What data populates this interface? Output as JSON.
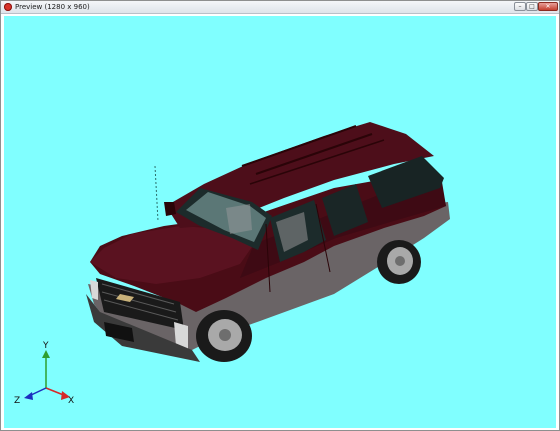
{
  "window": {
    "title": "Preview (1280 x 960)",
    "min_label": "–",
    "max_label": "□",
    "close_label": "✕"
  },
  "viewport": {
    "background": "#80ffff",
    "model": "maroon-suv",
    "axes": {
      "x_label": "X",
      "y_label": "Y",
      "z_label": "Z"
    }
  }
}
